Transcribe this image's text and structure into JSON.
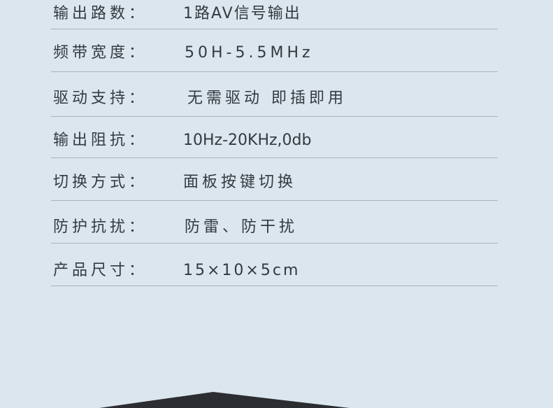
{
  "specs": [
    {
      "label": "输出路数：",
      "value": "1路AV信号输出"
    },
    {
      "label": "频带宽度：",
      "value": "50H-5.5MHz"
    },
    {
      "label": "驱动支持：",
      "value": "无需驱动 即插即用"
    },
    {
      "label": "输出阻抗：",
      "value": "10Hz-20KHz,0db"
    },
    {
      "label": "切换方式：",
      "value": "面板按键切换"
    },
    {
      "label": "防护抗扰：",
      "value": "防雷、防干扰"
    },
    {
      "label": "产品尺寸：",
      "value": "15×10×5cm"
    }
  ],
  "colors": {
    "background": "#dbe6ef",
    "text": "#333a40",
    "divider": "#a9b3bb",
    "device": "#2b2d30"
  }
}
